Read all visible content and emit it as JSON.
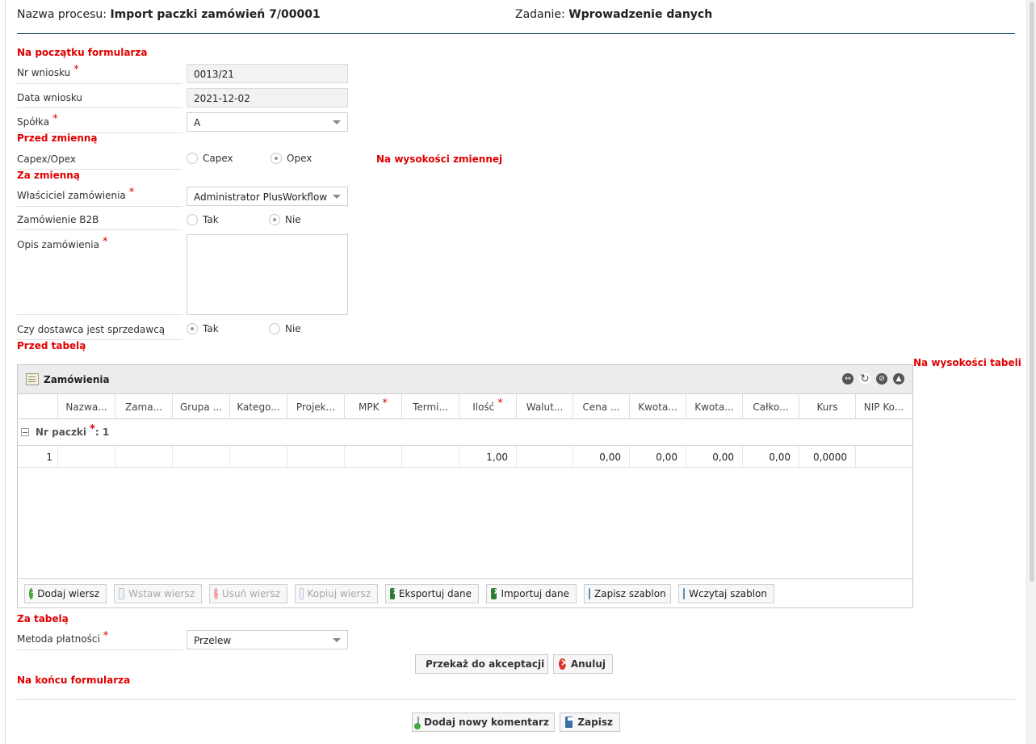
{
  "header": {
    "process_label": "Nazwa procesu:",
    "process_name": "Import paczki zamówień 7/00001",
    "task_label": "Zadanie:",
    "task_name": "Wprowadzenie danych"
  },
  "markers": {
    "form_start": "Na początku formularza",
    "before_variable": "Przed zmienną",
    "at_variable": "Na wysokości zmiennej",
    "after_variable": "Za zmienną",
    "before_table": "Przed tabelą",
    "at_table": "Na wysokości tabeli",
    "after_table": "Za tabelą",
    "form_end": "Na końcu formularza"
  },
  "fields": {
    "nr_wniosku": {
      "label": "Nr wniosku",
      "value": "0013/21",
      "required": "*"
    },
    "data_wniosku": {
      "label": "Data wniosku",
      "value": "2021-12-02"
    },
    "spolka": {
      "label": "Spółka",
      "value": "A",
      "required": "*"
    },
    "capex_opex": {
      "label": "Capex/Opex",
      "option1": "Capex",
      "option2": "Opex",
      "selected": "Opex"
    },
    "wlasciciel": {
      "label": "Właściciel zamówienia",
      "value": "Administrator PlusWorkflow",
      "required": "*"
    },
    "b2b": {
      "label": "Zamówienie B2B",
      "option1": "Tak",
      "option2": "Nie",
      "selected": "Nie"
    },
    "opis": {
      "label": "Opis zamówienia",
      "value": "",
      "required": "*"
    },
    "dostawca": {
      "label": "Czy dostawca jest sprzedawcą",
      "option1": "Tak",
      "option2": "Nie",
      "selected": "Tak"
    },
    "metoda_platnosci": {
      "label": "Metoda płatności",
      "value": "Przelew",
      "required": "*"
    }
  },
  "grid": {
    "title": "Zamówienia",
    "columns": [
      "",
      "Nazwa...",
      "Zama...",
      "Grupa ...",
      "Katego...",
      "Projek...",
      "MPK",
      "Termi...",
      "Ilość",
      "Walut...",
      "Cena ...",
      "Kwota...",
      "Kwota...",
      "Całko...",
      "Kurs",
      "NIP Ko..."
    ],
    "required_mark": "*",
    "group_label": "Nr paczki",
    "group_value": ": 1",
    "rows": [
      [
        "1",
        "",
        "",
        "",
        "",
        "",
        "",
        "",
        "1,00",
        "",
        "0,00",
        "0,00",
        "0,00",
        "0,00",
        "0,0000",
        ""
      ]
    ],
    "toolbar": {
      "add_row": "Dodaj wiersz",
      "insert_row": "Wstaw wiersz",
      "delete_row": "Usuń wiersz",
      "copy_row": "Kopiuj wiersz",
      "export": "Eksportuj dane",
      "import": "Importuj dane",
      "save_template": "Zapisz szablon",
      "load_template": "Wczytaj szablon"
    }
  },
  "actions": {
    "accept": "Przekaż do akceptacji",
    "cancel": "Anuluj",
    "add_comment": "Dodaj nowy komentarz",
    "save": "Zapisz"
  }
}
